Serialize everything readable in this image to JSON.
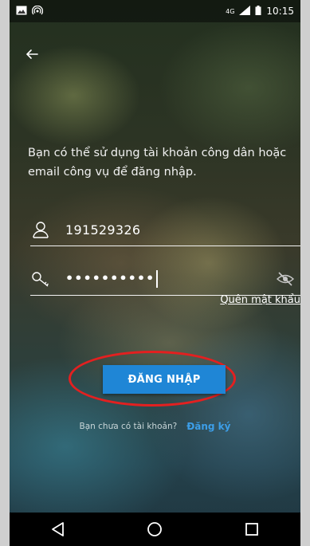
{
  "status_bar": {
    "time": "10:15",
    "icons": [
      "image-icon",
      "hotspot-icon",
      "network-4g-icon",
      "signal-icon",
      "battery-icon"
    ],
    "network_label": "4G"
  },
  "header": {
    "back_icon": "back-arrow-icon"
  },
  "description": "Bạn có thể sử dụng tài khoản công dân hoặc email công vụ để đăng nhập.",
  "username": {
    "icon": "user-icon",
    "value": "191529326"
  },
  "password": {
    "icon": "key-icon",
    "value": "••••••••••",
    "visibility_icon": "eye-off-icon"
  },
  "forgot_password_label": "Quên mật khẩu",
  "login_button_label": "ĐĂNG NHẬP",
  "signup": {
    "question": "Bạn chưa có tài khoản?",
    "link_label": "Đăng ký"
  },
  "nav_bar": {
    "buttons": [
      "back-triangle-icon",
      "home-circle-icon",
      "recents-square-icon"
    ]
  },
  "colors": {
    "accent": "#1f86d6",
    "link": "#3c9ee8",
    "highlight": "#e32020"
  }
}
